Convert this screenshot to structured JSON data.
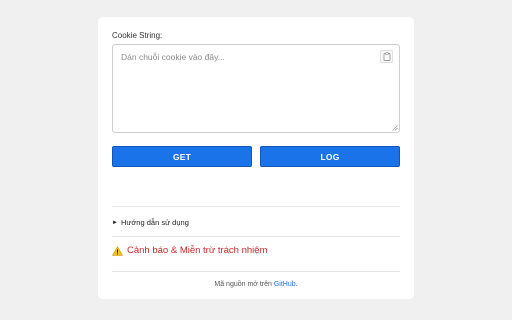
{
  "form": {
    "label": "Cookie String:",
    "placeholder": "Dán chuỗi cookie vào đây..."
  },
  "buttons": {
    "get": "GET",
    "log": "LOG"
  },
  "guide": {
    "arrow": "►",
    "label": "Hướng dẫn sử dụng"
  },
  "warning": {
    "icon": "warning-icon",
    "label": "Cảnh báo & Miễn trừ trách nhiệm",
    "color": "#c62828"
  },
  "footer": {
    "prefix": "Mã nguồn mở trên ",
    "link": "GitHub",
    "suffix": "."
  },
  "colors": {
    "accent": "#1a73e8",
    "background": "#f0f0f0"
  }
}
